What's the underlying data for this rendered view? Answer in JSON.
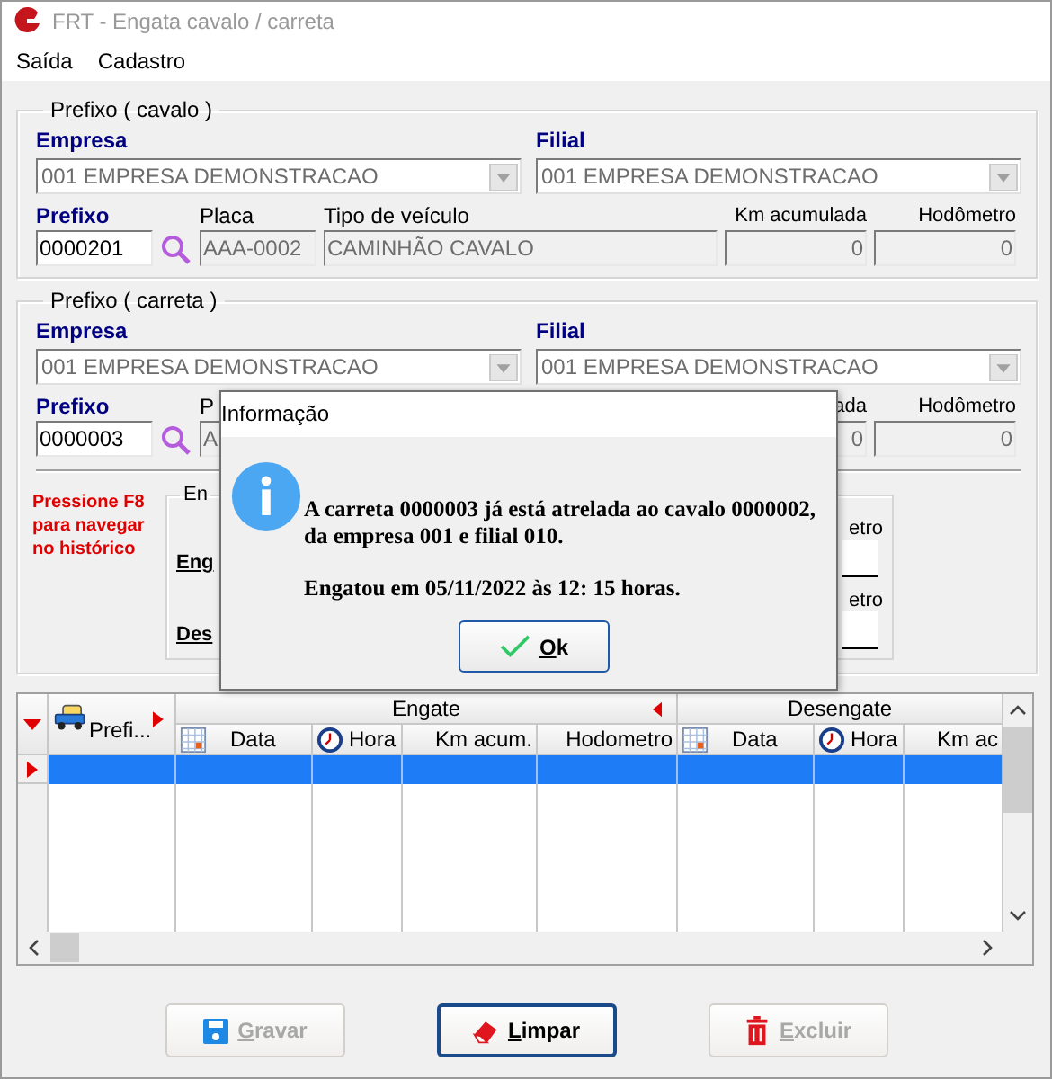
{
  "window": {
    "title": "FRT - Engata cavalo / carreta",
    "active": false
  },
  "menu": [
    {
      "label": "Saída"
    },
    {
      "label": "Cadastro"
    }
  ],
  "groups": [
    {
      "legend": "Prefixo ( cavalo )",
      "empresa": {
        "label": "Empresa",
        "value": "001 EMPRESA DEMONSTRACAO",
        "disabled": true
      },
      "filial": {
        "label": "Filial",
        "value": "001 EMPRESA DEMONSTRACAO",
        "disabled": true
      },
      "prefixo": {
        "label": "Prefixo",
        "value": "0000201",
        "readonly": false
      },
      "placa": {
        "label": "Placa",
        "value": "AAA-0002",
        "readonly": true
      },
      "tipo": {
        "label": "Tipo de veículo",
        "value": "CAMINHÃO CAVALO",
        "readonly": true
      },
      "km": {
        "label": "Km acumulada",
        "value": "0",
        "readonly": true
      },
      "hodometro": {
        "label": "Hodômetro",
        "value": "0",
        "readonly": true
      }
    },
    {
      "legend": "Prefixo ( carreta )",
      "empresa": {
        "label": "Empresa",
        "value": "001 EMPRESA DEMONSTRACAO",
        "disabled": true
      },
      "filial": {
        "label": "Filial",
        "value": "001 EMPRESA DEMONSTRACAO",
        "disabled": true
      },
      "prefixo": {
        "label": "Prefixo",
        "value": "0000003",
        "readonly": false
      },
      "placa": {
        "label": "P",
        "value": "A",
        "readonly": true
      },
      "km": {
        "label": "ada",
        "value": "0",
        "readonly": true
      },
      "hodometro": {
        "label": "Hodômetro",
        "value": "0",
        "readonly": true
      },
      "hint": "Pressione F8 para navegar no histórico",
      "history": {
        "legend": "En",
        "rows": [
          {
            "label": "Eng",
            "field_label": "etro"
          },
          {
            "label": "Des",
            "field_label": "etro"
          }
        ]
      }
    }
  ],
  "grid": {
    "groups": [
      {
        "label": "Engate",
        "expanded": true
      },
      {
        "label": "Desengate"
      }
    ],
    "columns": [
      {
        "label": "Prefi...",
        "kind": "vehicle",
        "expanded": false
      },
      {
        "label": "Data",
        "kind": "date"
      },
      {
        "label": "Hora",
        "kind": "time"
      },
      {
        "label": "Km acum.",
        "kind": "number"
      },
      {
        "label": "Hodometro",
        "kind": "number"
      },
      {
        "label": "Data",
        "kind": "date"
      },
      {
        "label": "Hora",
        "kind": "time"
      },
      {
        "label": "Km ac",
        "kind": "number"
      }
    ],
    "rows": [
      {
        "selected": true
      }
    ]
  },
  "buttons": [
    {
      "label": "Gravar",
      "kind": "save",
      "disabled": true,
      "focused": false
    },
    {
      "label": "Limpar",
      "kind": "clear",
      "disabled": false,
      "focused": true
    },
    {
      "label": "Excluir",
      "kind": "delete",
      "disabled": true,
      "focused": false
    }
  ],
  "dialog": {
    "title": "Informação",
    "kind": "info",
    "paragraphs": [
      "A carreta 0000003 já está atrelada ao cavalo 0000002, da empresa 001 e filial 010.",
      "Engatou em 05/11/2022 às 12: 15 horas."
    ],
    "button": "Ok"
  }
}
